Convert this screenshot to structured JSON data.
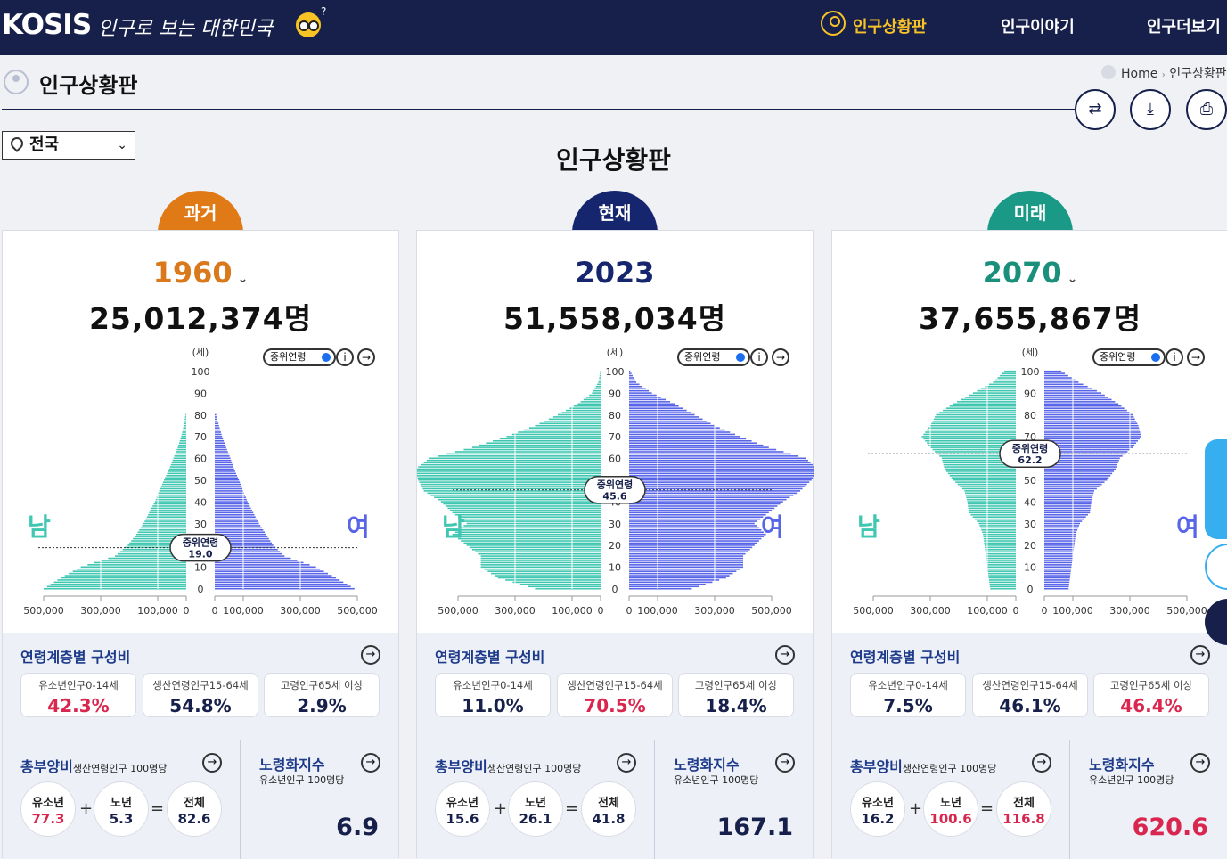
{
  "header": {
    "logo": "KOSIS",
    "slogan": "인구로 보는 대한민국",
    "nav": [
      "인구상황판",
      "인구이야기",
      "인구더보기"
    ]
  },
  "page": {
    "title": "인구상황판",
    "breadcrumb_home": "Home",
    "breadcrumb_current": "인구상황판",
    "region": "전국",
    "main_title": "인구상황판"
  },
  "labels": {
    "unit_age": "(세)",
    "male": "남",
    "female": "여",
    "median_toggle": "중위연령",
    "median_label": "중위연령",
    "info": "i",
    "age_comp_title": "연령계층별 구성비",
    "youth": "유소년인구0-14세",
    "working": "생산연령인구15-64세",
    "elderly": "고령인구65세 이상",
    "dep_title": "총부양비",
    "dep_sub": "생산연령인구 100명당",
    "dep_youth": "유소년",
    "dep_old": "노년",
    "dep_total": "전체",
    "aging_title": "노령화지수",
    "aging_sub": "유소년인구 100명당",
    "x_ticks": [
      "500,000",
      "300,000",
      "100,000",
      "0",
      "0",
      "100,000",
      "300,000",
      "500,000"
    ],
    "y_ticks": [
      "100",
      "90",
      "80",
      "70",
      "60",
      "50",
      "40",
      "30",
      "20",
      "10",
      "0"
    ]
  },
  "panels": [
    {
      "tab": "과거",
      "tab_color": "#e07a17",
      "year_color": "#d9791b",
      "year": "1960",
      "population": "25,012,374명",
      "median_age": "19.0",
      "median_age_num": 19.0,
      "youth_pct": "42.3%",
      "working_pct": "54.8%",
      "elderly_pct": "2.9%",
      "dep_youth": "77.3",
      "dep_old": "5.3",
      "dep_total": "82.6",
      "aging_index": "6.9",
      "pyramid": {
        "max_age": 80,
        "male": [
          [
            0,
            500000
          ],
          [
            5,
            440000
          ],
          [
            10,
            370000
          ],
          [
            15,
            250000
          ],
          [
            20,
            205000
          ],
          [
            25,
            175000
          ],
          [
            30,
            150000
          ],
          [
            35,
            130000
          ],
          [
            40,
            110000
          ],
          [
            45,
            95000
          ],
          [
            50,
            78000
          ],
          [
            55,
            60000
          ],
          [
            60,
            45000
          ],
          [
            65,
            30000
          ],
          [
            70,
            18000
          ],
          [
            75,
            9000
          ],
          [
            80,
            3000
          ]
        ],
        "female": [
          [
            0,
            490000
          ],
          [
            5,
            425000
          ],
          [
            10,
            355000
          ],
          [
            15,
            245000
          ],
          [
            20,
            205000
          ],
          [
            25,
            180000
          ],
          [
            30,
            155000
          ],
          [
            35,
            135000
          ],
          [
            40,
            115000
          ],
          [
            45,
            100000
          ],
          [
            50,
            85000
          ],
          [
            55,
            68000
          ],
          [
            60,
            55000
          ],
          [
            65,
            40000
          ],
          [
            70,
            26000
          ],
          [
            75,
            15000
          ],
          [
            80,
            5000
          ]
        ]
      }
    },
    {
      "tab": "현재",
      "tab_color": "#16266e",
      "year_color": "#16266e",
      "year": "2023",
      "population": "51,558,034명",
      "median_age": "45.6",
      "median_age_num": 45.6,
      "youth_pct": "11.0%",
      "working_pct": "70.5%",
      "elderly_pct": "18.4%",
      "dep_youth": "15.6",
      "dep_old": "26.1",
      "dep_total": "41.8",
      "aging_index": "167.1",
      "pyramid": {
        "max_age": 100,
        "male": [
          [
            0,
            230000
          ],
          [
            5,
            360000
          ],
          [
            10,
            420000
          ],
          [
            15,
            420000
          ],
          [
            20,
            470000
          ],
          [
            25,
            520000
          ],
          [
            30,
            470000
          ],
          [
            35,
            520000
          ],
          [
            40,
            560000
          ],
          [
            45,
            620000
          ],
          [
            50,
            640000
          ],
          [
            55,
            650000
          ],
          [
            60,
            600000
          ],
          [
            65,
            450000
          ],
          [
            70,
            330000
          ],
          [
            75,
            230000
          ],
          [
            80,
            150000
          ],
          [
            85,
            80000
          ],
          [
            90,
            30000
          ],
          [
            95,
            8000
          ],
          [
            100,
            1000
          ]
        ],
        "female": [
          [
            0,
            220000
          ],
          [
            5,
            340000
          ],
          [
            10,
            400000
          ],
          [
            15,
            400000
          ],
          [
            20,
            440000
          ],
          [
            25,
            480000
          ],
          [
            30,
            440000
          ],
          [
            35,
            490000
          ],
          [
            40,
            540000
          ],
          [
            45,
            600000
          ],
          [
            50,
            640000
          ],
          [
            55,
            660000
          ],
          [
            60,
            620000
          ],
          [
            65,
            490000
          ],
          [
            70,
            390000
          ],
          [
            75,
            300000
          ],
          [
            80,
            230000
          ],
          [
            85,
            160000
          ],
          [
            90,
            80000
          ],
          [
            95,
            25000
          ],
          [
            100,
            4000
          ]
        ]
      }
    },
    {
      "tab": "미래",
      "tab_color": "#1a9a86",
      "year_color": "#1a8f7c",
      "year": "2070",
      "population": "37,655,867명",
      "median_age": "62.2",
      "median_age_num": 62.2,
      "youth_pct": "7.5%",
      "working_pct": "46.1%",
      "elderly_pct": "46.4%",
      "dep_youth": "16.2",
      "dep_old": "100.6",
      "dep_total": "116.8",
      "aging_index": "620.6",
      "pyramid": {
        "max_age": 100,
        "male": [
          [
            0,
            90000
          ],
          [
            5,
            95000
          ],
          [
            10,
            100000
          ],
          [
            15,
            105000
          ],
          [
            20,
            110000
          ],
          [
            25,
            115000
          ],
          [
            30,
            130000
          ],
          [
            35,
            165000
          ],
          [
            40,
            170000
          ],
          [
            45,
            180000
          ],
          [
            50,
            220000
          ],
          [
            55,
            250000
          ],
          [
            60,
            260000
          ],
          [
            65,
            300000
          ],
          [
            70,
            330000
          ],
          [
            75,
            300000
          ],
          [
            80,
            280000
          ],
          [
            85,
            220000
          ],
          [
            90,
            150000
          ],
          [
            95,
            80000
          ],
          [
            100,
            40000
          ]
        ],
        "female": [
          [
            0,
            85000
          ],
          [
            5,
            90000
          ],
          [
            10,
            95000
          ],
          [
            15,
            100000
          ],
          [
            20,
            105000
          ],
          [
            25,
            110000
          ],
          [
            30,
            125000
          ],
          [
            35,
            160000
          ],
          [
            40,
            165000
          ],
          [
            45,
            175000
          ],
          [
            50,
            220000
          ],
          [
            55,
            250000
          ],
          [
            60,
            265000
          ],
          [
            65,
            310000
          ],
          [
            70,
            340000
          ],
          [
            75,
            330000
          ],
          [
            80,
            310000
          ],
          [
            85,
            260000
          ],
          [
            90,
            200000
          ],
          [
            95,
            120000
          ],
          [
            100,
            60000
          ]
        ]
      }
    }
  ]
}
